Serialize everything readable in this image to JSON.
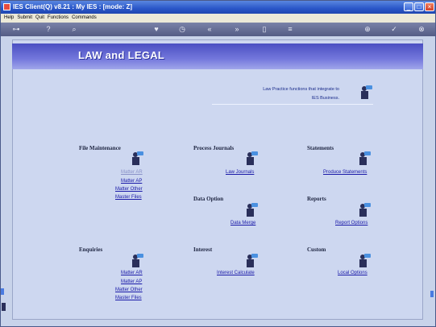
{
  "window": {
    "title": "IES Client(Q) v8.21 : My IES :     [mode: Z]"
  },
  "menu": [
    "Help",
    "Submit",
    "Quit",
    "Functions",
    "Commands"
  ],
  "header": {
    "title": "LAW and LEGAL"
  },
  "intro": {
    "line1": "Law Practice functions that integrate to",
    "line2": "IES Business."
  },
  "sections": {
    "file_maintenance": {
      "title": "File Maintenance",
      "links": [
        "Matter AR",
        "Matter AP",
        "Matter Other",
        "Master Files"
      ]
    },
    "process_journals": {
      "title": "Process Journals",
      "links": [
        "Law Journals"
      ]
    },
    "statements": {
      "title": "Statements",
      "links": [
        "Produce Statements"
      ]
    },
    "data_option": {
      "title": "Data Option",
      "links": [
        "Data Merge"
      ]
    },
    "reports": {
      "title": "Reports",
      "links": [
        "Report Options"
      ]
    },
    "enquiries": {
      "title": "Enquiries",
      "links": [
        "Matter AR",
        "Matter AP",
        "Matter Other",
        "Master Files"
      ]
    },
    "interest": {
      "title": "Interest",
      "links": [
        "Interest Calculate"
      ]
    },
    "custom": {
      "title": "Custom",
      "links": [
        "Local Options"
      ]
    }
  },
  "colors": {
    "link": "#1a1aa8",
    "header": "#4a4fc2",
    "background": "#cdd7f0"
  },
  "icons": {
    "toolbar": [
      "key-icon",
      "help-icon",
      "search-icon",
      "heart-icon",
      "clock-icon",
      "rewind-icon",
      "fast-forward-icon",
      "calendar-icon",
      "notes-icon",
      "add-icon",
      "check-icon",
      "close-icon"
    ]
  }
}
